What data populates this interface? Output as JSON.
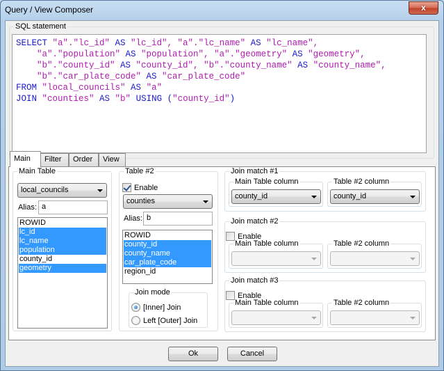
{
  "window": {
    "title": "Query / View Composer",
    "close_label": "x"
  },
  "sql": {
    "group_label": "SQL statement",
    "tokens": [
      [
        [
          "kw",
          "SELECT "
        ],
        [
          "st",
          "\"a\".\"lc_id\" "
        ],
        [
          "kw",
          "AS "
        ],
        [
          "st",
          "\"lc_id\", \"a\".\"lc_name\" "
        ],
        [
          "kw",
          "AS "
        ],
        [
          "st",
          "\"lc_name\","
        ]
      ],
      [
        [
          "st",
          "    \"a\".\"population\" "
        ],
        [
          "kw",
          "AS "
        ],
        [
          "st",
          "\"population\", \"a\".\"geometry\" "
        ],
        [
          "kw",
          "AS "
        ],
        [
          "st",
          "\"geometry\","
        ]
      ],
      [
        [
          "st",
          "    \"b\".\"county_id\" "
        ],
        [
          "kw",
          "AS "
        ],
        [
          "st",
          "\"county_id\", \"b\".\"county_name\" "
        ],
        [
          "kw",
          "AS "
        ],
        [
          "st",
          "\"county_name\","
        ]
      ],
      [
        [
          "st",
          "    \"b\".\"car_plate_code\" "
        ],
        [
          "kw",
          "AS "
        ],
        [
          "st",
          "\"car_plate_code\""
        ]
      ],
      [
        [
          "kw",
          "FROM "
        ],
        [
          "st",
          "\"local_councils\" "
        ],
        [
          "kw",
          "AS "
        ],
        [
          "st",
          "\"a\""
        ]
      ],
      [
        [
          "kw",
          "JOIN "
        ],
        [
          "st",
          "\"counties\" "
        ],
        [
          "kw",
          "AS "
        ],
        [
          "st",
          "\"b\" "
        ],
        [
          "kw",
          "USING ("
        ],
        [
          "st",
          "\"county_id\""
        ],
        [
          "kw",
          ")"
        ]
      ]
    ]
  },
  "tabs": [
    "Main",
    "Filter",
    "Order",
    "View"
  ],
  "active_tab": "Main",
  "main_table": {
    "group_label": "Main Table",
    "selected_table": "local_councils",
    "alias_label": "Alias:",
    "alias_value": "a",
    "columns": [
      {
        "name": "ROWID",
        "selected": false
      },
      {
        "name": "lc_id",
        "selected": true
      },
      {
        "name": "lc_name",
        "selected": true
      },
      {
        "name": "population",
        "selected": true
      },
      {
        "name": "county_id",
        "selected": false
      },
      {
        "name": "geometry",
        "selected": true
      }
    ]
  },
  "table2": {
    "group_label": "Table #2",
    "enable_label": "Enable",
    "enabled": true,
    "selected_table": "counties",
    "alias_label": "Alias:",
    "alias_value": "b",
    "columns": [
      {
        "name": "ROWID",
        "selected": false
      },
      {
        "name": "county_id",
        "selected": true
      },
      {
        "name": "county_name",
        "selected": true
      },
      {
        "name": "car_plate_code",
        "selected": true
      },
      {
        "name": "region_id",
        "selected": false
      }
    ],
    "join_mode": {
      "group_label": "Join mode",
      "options": [
        "[Inner] Join",
        "Left [Outer] Join"
      ],
      "selected": "[Inner] Join"
    }
  },
  "join_matches": [
    {
      "group_label": "Join match #1",
      "has_enable": false,
      "enabled": true,
      "main_col_label": "Main Table column",
      "t2_col_label": "Table #2 column",
      "main_col_value": "county_id",
      "t2_col_value": "county_id"
    },
    {
      "group_label": "Join match #2",
      "has_enable": true,
      "enable_label": "Enable",
      "enabled": false,
      "main_col_label": "Main Table column",
      "t2_col_label": "Table #2 column",
      "main_col_value": "",
      "t2_col_value": ""
    },
    {
      "group_label": "Join match #3",
      "has_enable": true,
      "enable_label": "Enable",
      "enabled": false,
      "main_col_label": "Main Table column",
      "t2_col_label": "Table #2 column",
      "main_col_value": "",
      "t2_col_value": ""
    }
  ],
  "buttons": {
    "ok": "Ok",
    "cancel": "Cancel"
  }
}
